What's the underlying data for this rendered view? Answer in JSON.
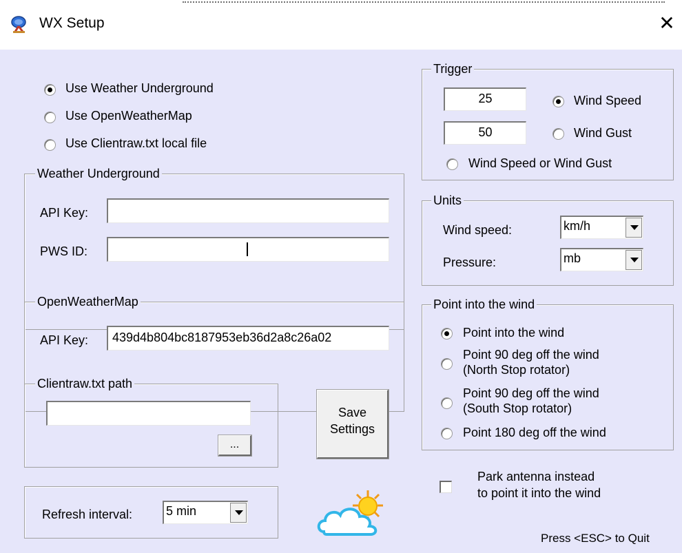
{
  "window": {
    "title": "WX Setup",
    "close_glyph": "✕",
    "app_icon": "satellite-dish-icon"
  },
  "source": {
    "options": [
      "Use Weather Underground",
      "Use OpenWeatherMap",
      "Use Clientraw.txt local file"
    ],
    "selected": "Use Weather Underground"
  },
  "wu": {
    "title": "Weather Underground",
    "api_label": "API Key:",
    "api_value": "",
    "pws_label": "PWS ID:",
    "pws_value": ""
  },
  "owm": {
    "title": "OpenWeatherMap",
    "api_label": "API Key:",
    "api_value": "439d4b804bc8187953eb36d2a8c26a02"
  },
  "clientraw": {
    "title": "Clientraw.txt path",
    "path_value": "",
    "browse_label": "..."
  },
  "refresh": {
    "label": "Refresh interval:",
    "value": "5 min"
  },
  "save": {
    "line1": "Save",
    "line2": "Settings"
  },
  "trigger": {
    "title": "Trigger",
    "speed_value": "25",
    "gust_value": "50",
    "options": [
      "Wind Speed",
      "Wind Gust",
      "Wind Speed or Wind Gust"
    ],
    "selected": "Wind Speed"
  },
  "units": {
    "title": "Units",
    "wind_label": "Wind speed:",
    "wind_value": "km/h",
    "pressure_label": "Pressure:",
    "pressure_value": "mb"
  },
  "point": {
    "title": "Point into the wind",
    "opt1": "Point into the wind",
    "opt2_l1": "Point 90 deg off the wind",
    "opt2_l2": "(North Stop rotator)",
    "opt3_l1": "Point 90 deg off the wind",
    "opt3_l2": "(South Stop rotator)",
    "opt4": "Point 180 deg off the wind",
    "selected": "Point into the wind"
  },
  "park": {
    "line1": "Park antenna instead",
    "line2": "to point it into the wind",
    "checked": false
  },
  "footer": {
    "quit_hint": "Press <ESC> to Quit",
    "weather_icon": "sun-behind-cloud-icon"
  }
}
